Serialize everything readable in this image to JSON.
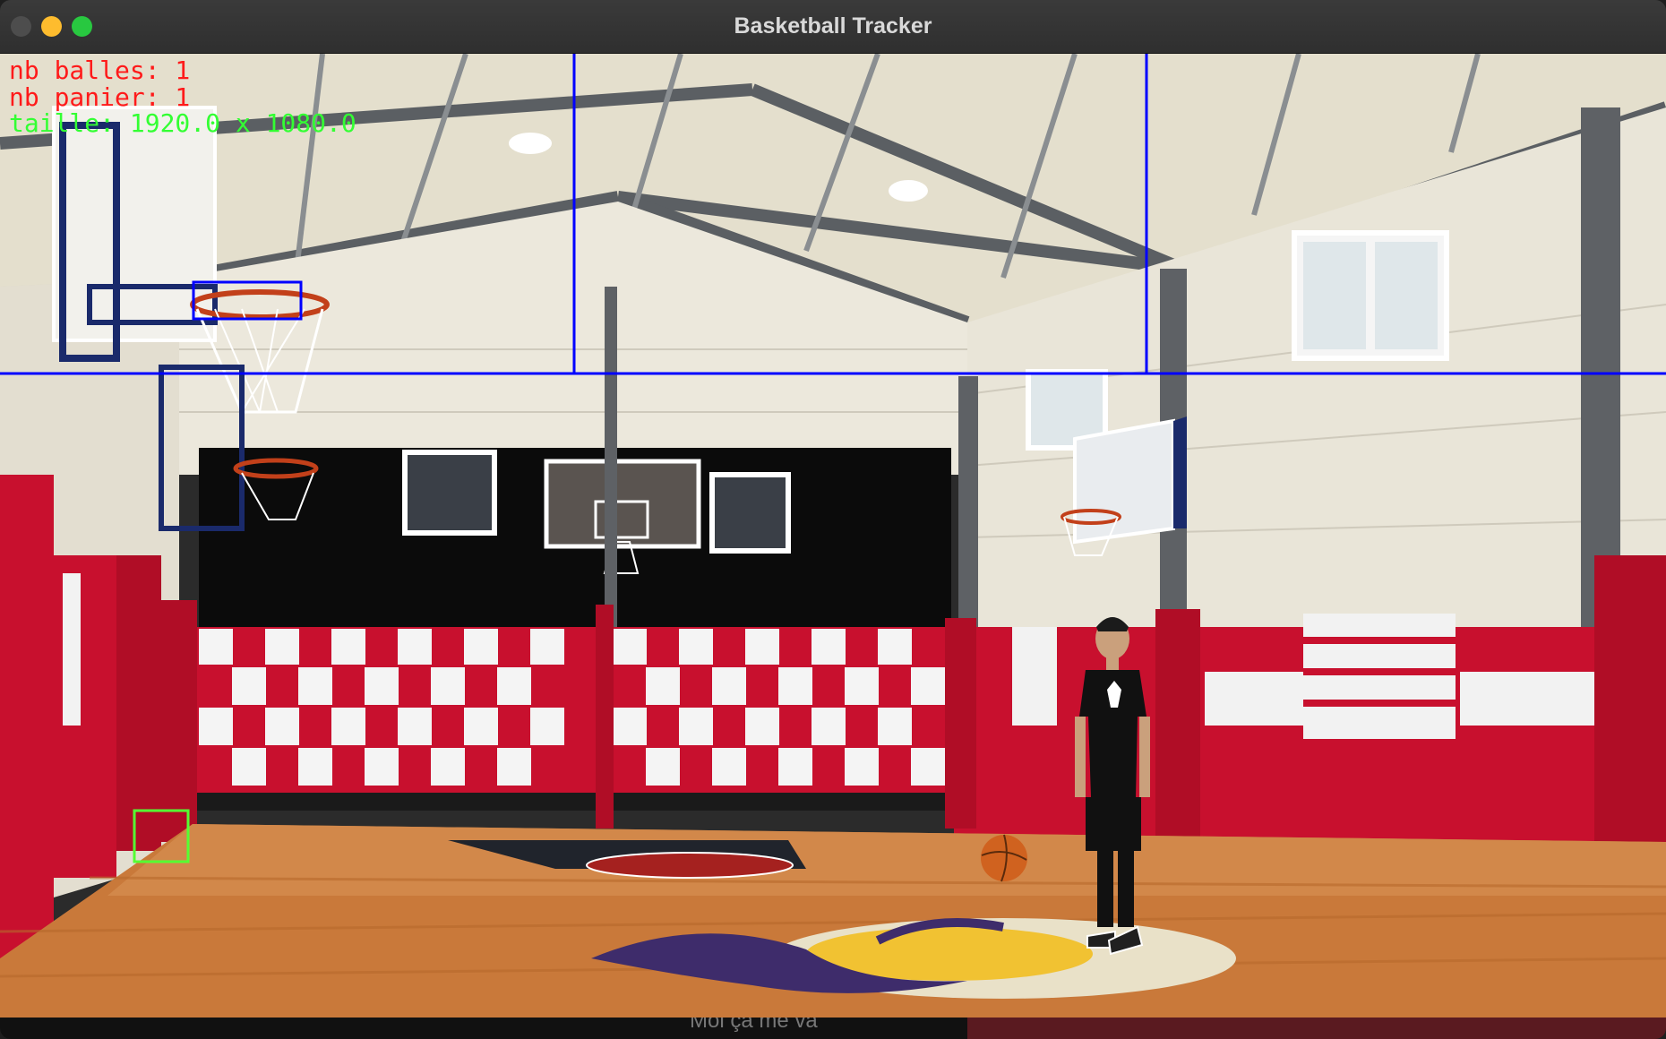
{
  "window": {
    "title": "Basketball Tracker",
    "traffic_lights": {
      "close": "#4d4d4d",
      "minimize": "#febc2e",
      "zoom": "#28c840"
    }
  },
  "overlay": {
    "nb_balles": "nb balles: 1",
    "nb_panier": "nb panier: 1",
    "taille": "taille: 1920.0 x 1080.0",
    "colors": {
      "count_text": "#ff1a1a",
      "size_text": "#33ff33",
      "zone_lines": "#0000ff",
      "hoop_box": "#0000ff",
      "ball_box": "#55ff33"
    }
  },
  "bottom_strip": {
    "caption": "Moi ça me va"
  }
}
